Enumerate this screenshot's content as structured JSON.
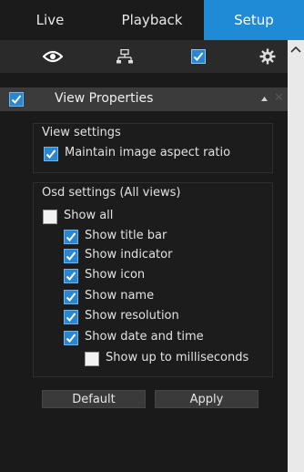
{
  "tabs": {
    "live": "Live",
    "playback": "Playback",
    "setup": "Setup"
  },
  "toolbar": {
    "icons": [
      "eye-icon",
      "network-icon",
      "checkbox-icon",
      "gear-icon"
    ]
  },
  "panel": {
    "title": "View Properties"
  },
  "view_settings": {
    "heading": "View settings",
    "maintain_aspect": {
      "label": "Maintain image aspect ratio",
      "checked": true
    }
  },
  "osd_settings": {
    "heading": "Osd settings (All views)",
    "show_all": {
      "label": "Show all",
      "checked": false
    },
    "items": [
      {
        "label": "Show title bar",
        "checked": true
      },
      {
        "label": "Show indicator",
        "checked": true
      },
      {
        "label": "Show icon",
        "checked": true
      },
      {
        "label": "Show name",
        "checked": true
      },
      {
        "label": "Show resolution",
        "checked": true
      },
      {
        "label": "Show date and time",
        "checked": true
      }
    ],
    "milliseconds": {
      "label": "Show up to milliseconds",
      "checked": false
    }
  },
  "buttons": {
    "default": "Default",
    "apply": "Apply"
  },
  "colors": {
    "accent": "#1f8ad6",
    "checkbox": "#2a86d0"
  }
}
